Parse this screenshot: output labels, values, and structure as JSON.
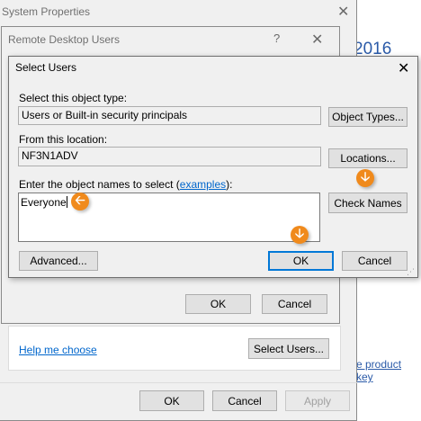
{
  "background": {
    "year_text": "2016",
    "product_key_link": "e product key"
  },
  "system_properties": {
    "title": "System Properties",
    "ok_label": "OK",
    "cancel_label": "Cancel",
    "apply_label": "Apply"
  },
  "remote_desktop_users": {
    "title": "Remote Desktop Users",
    "help_label": "?",
    "help_link": "Help me choose",
    "select_users_label": "Select Users...",
    "ok_label": "OK",
    "cancel_label": "Cancel"
  },
  "select_users": {
    "title": "Select Users",
    "object_type_label": "Select this object type:",
    "object_type_value": "Users or Built-in security principals",
    "object_types_button": "Object Types...",
    "location_label": "From this location:",
    "location_value": "NF3N1ADV",
    "locations_button": "Locations...",
    "names_label_prefix": "Enter the object names to select (",
    "names_label_link": "examples",
    "names_label_suffix": "):",
    "names_value": "Everyone",
    "check_names_button": "Check Names",
    "advanced_button": "Advanced...",
    "ok_button": "OK",
    "cancel_button": "Cancel"
  },
  "markers": {
    "down_arrow": "🡣",
    "left_arrow": "🡠"
  },
  "colors": {
    "accent": "#0078d7",
    "marker": "#f08a1c",
    "link": "#0066cc"
  }
}
